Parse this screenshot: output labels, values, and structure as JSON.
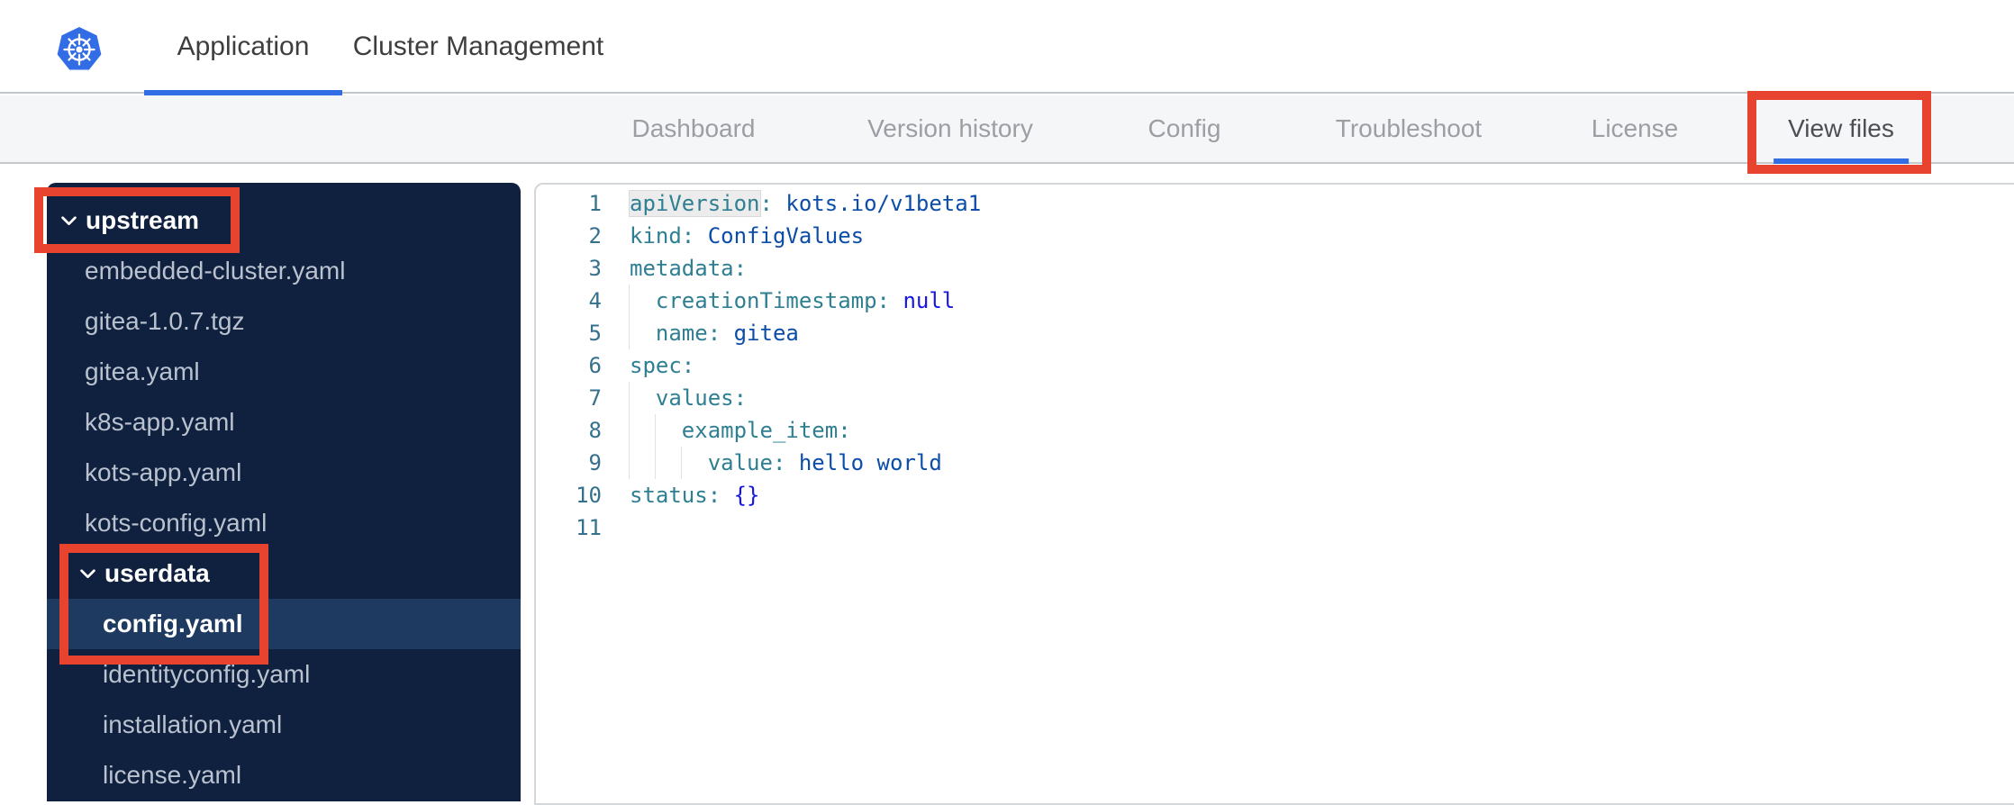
{
  "colors": {
    "accent_blue": "#326de6",
    "annotation_red": "#e8432f",
    "sidebar_bg": "#10203f",
    "sidebar_selected_bg": "#1e3a61",
    "yaml_key": "#2f7f93",
    "yaml_string": "#0b4da8",
    "yaml_keyword": "#1515e6"
  },
  "topbar": {
    "logo": "kubernetes-logo",
    "tabs": [
      {
        "label": "Application",
        "active": true
      },
      {
        "label": "Cluster Management",
        "active": false
      }
    ]
  },
  "subnav": {
    "items": [
      {
        "label": "Dashboard",
        "active": false
      },
      {
        "label": "Version history",
        "active": false
      },
      {
        "label": "Config",
        "active": false
      },
      {
        "label": "Troubleshoot",
        "active": false
      },
      {
        "label": "License",
        "active": false
      },
      {
        "label": "View files",
        "active": true,
        "annotated": true
      }
    ]
  },
  "sidebar": {
    "tree": [
      {
        "type": "folder",
        "label": "upstream",
        "level": 0,
        "expanded": true,
        "annotated": true
      },
      {
        "type": "file",
        "label": "embedded-cluster.yaml",
        "level": 1
      },
      {
        "type": "file",
        "label": "gitea-1.0.7.tgz",
        "level": 1
      },
      {
        "type": "file",
        "label": "gitea.yaml",
        "level": 1
      },
      {
        "type": "file",
        "label": "k8s-app.yaml",
        "level": 1
      },
      {
        "type": "file",
        "label": "kots-app.yaml",
        "level": 1
      },
      {
        "type": "file",
        "label": "kots-config.yaml",
        "level": 1
      },
      {
        "type": "folder",
        "label": "userdata",
        "level": 1,
        "expanded": true,
        "annotated": true
      },
      {
        "type": "file",
        "label": "config.yaml",
        "level": 2,
        "selected": true,
        "annotated": true
      },
      {
        "type": "file",
        "label": "identityconfig.yaml",
        "level": 2
      },
      {
        "type": "file",
        "label": "installation.yaml",
        "level": 2
      },
      {
        "type": "file",
        "label": "license.yaml",
        "level": 2
      }
    ]
  },
  "editor": {
    "lines": [
      {
        "n": 1,
        "guides": 0,
        "tokens": [
          [
            "key-hl",
            "apiVersion"
          ],
          [
            "key",
            ":"
          ],
          [
            "str",
            " kots.io/v1beta1"
          ]
        ]
      },
      {
        "n": 2,
        "guides": 0,
        "tokens": [
          [
            "key",
            "kind:"
          ],
          [
            "str",
            " ConfigValues"
          ]
        ]
      },
      {
        "n": 3,
        "guides": 0,
        "tokens": [
          [
            "key",
            "metadata:"
          ]
        ]
      },
      {
        "n": 4,
        "guides": 1,
        "tokens": [
          [
            "plain",
            "  "
          ],
          [
            "key",
            "creationTimestamp:"
          ],
          [
            "kw",
            " null"
          ]
        ]
      },
      {
        "n": 5,
        "guides": 1,
        "tokens": [
          [
            "plain",
            "  "
          ],
          [
            "key",
            "name:"
          ],
          [
            "str",
            " gitea"
          ]
        ]
      },
      {
        "n": 6,
        "guides": 0,
        "tokens": [
          [
            "key",
            "spec:"
          ]
        ]
      },
      {
        "n": 7,
        "guides": 1,
        "tokens": [
          [
            "plain",
            "  "
          ],
          [
            "key",
            "values:"
          ]
        ]
      },
      {
        "n": 8,
        "guides": 2,
        "tokens": [
          [
            "plain",
            "    "
          ],
          [
            "key",
            "example_item:"
          ]
        ]
      },
      {
        "n": 9,
        "guides": 3,
        "tokens": [
          [
            "plain",
            "      "
          ],
          [
            "key",
            "value:"
          ],
          [
            "str",
            " hello world"
          ]
        ]
      },
      {
        "n": 10,
        "guides": 0,
        "tokens": [
          [
            "key",
            "status:"
          ],
          [
            "kw",
            " {}"
          ]
        ]
      },
      {
        "n": 11,
        "guides": 0,
        "tokens": []
      }
    ]
  }
}
